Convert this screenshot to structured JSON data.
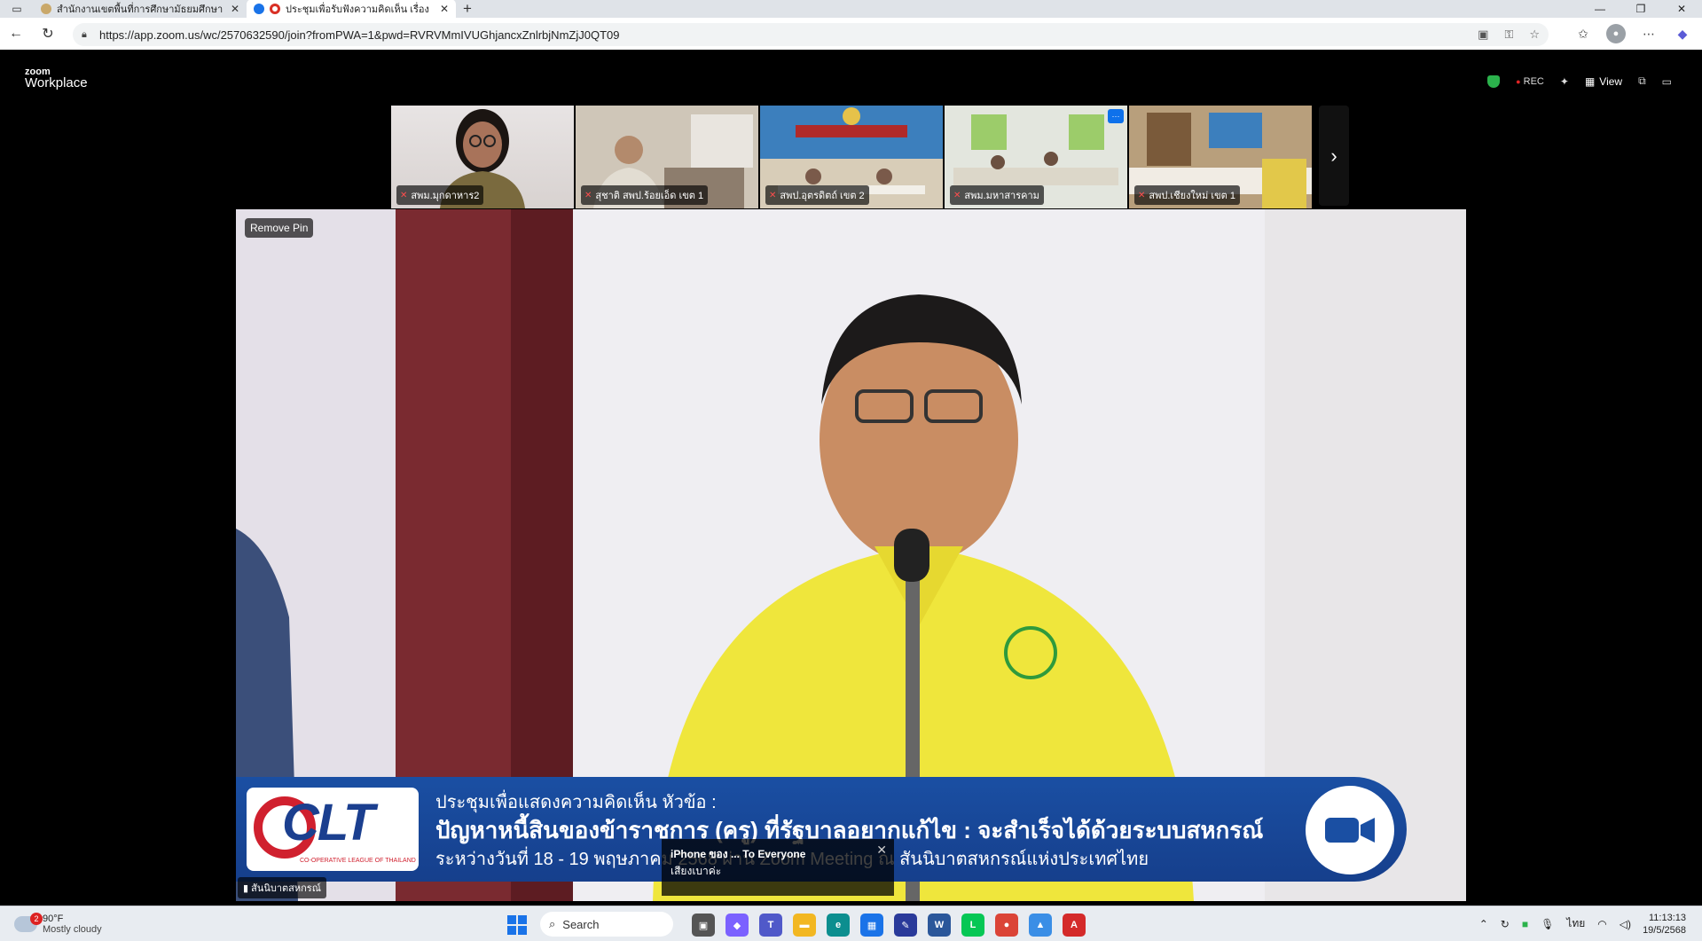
{
  "browser": {
    "tabs": [
      {
        "title": "สำนักงานเขตพื้นที่การศึกษามัธยมศึกษา",
        "favicon_color": "#c9a86a"
      },
      {
        "title": "ประชุมเพื่อรับฟังความคิดเห็น เรื่อง",
        "favicon_color": "#d93025"
      }
    ],
    "url": "https://app.zoom.us/wc/2570632590/join?fromPWA=1&pwd=RVRVMmIVUGhjancxZnlrbjNmZjJ0QT09"
  },
  "zoom": {
    "logo_small": "zoom",
    "logo_big": "Workplace",
    "rec_label": "REC",
    "view_label": "View",
    "participants": [
      {
        "name": "สพม.มุกดาหาร2"
      },
      {
        "name": "สุชาติ สพป.ร้อยเอ็ด เขต 1"
      },
      {
        "name": "สพป.อุตรดิตถ์ เขต 2"
      },
      {
        "name": "สพม.มหาสารคาม"
      },
      {
        "name": "สพป.เชียงใหม่ เขต 1"
      }
    ],
    "main_video": {
      "remove_pin_label": "Remove Pin",
      "speaker_name": "สันนิบาตสหกรณ์",
      "banner_logo": "CLT",
      "banner_logo_sub": "CO-OPERATIVE LEAGUE OF THAILAND",
      "banner_line1": "ประชุมเพื่อแสดงความคิดเห็น หัวข้อ :",
      "banner_line2": "ปัญหาหนี้สินของข้าราชการ (ครู) ที่รัฐบาลอยากแก้ไข : จะสำเร็จได้ด้วยระบบสหกรณ์",
      "banner_line3": "ระหว่างวันที่ 18 - 19 พฤษภาคม 2568 ผ่าน Zoom Meeting ณ สันนิบาตสหกรณ์แห่งประเทศไทย"
    },
    "chat_popup": {
      "from": "iPhone ของ ... To Everyone",
      "message": "เสียงเบาค่ะ"
    }
  },
  "taskbar": {
    "weather_temp": "90°F",
    "weather_cond": "Mostly cloudy",
    "weather_badge": "2",
    "search_placeholder": "Search",
    "language": "ไทย",
    "time": "11:13:13",
    "date": "19/5/2568"
  }
}
